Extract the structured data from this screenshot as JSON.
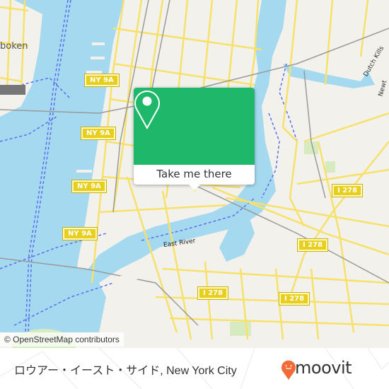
{
  "map": {
    "attribution": "© OpenStreetMap contributors",
    "place_labels": [
      {
        "id": "hoboken",
        "text": "boken"
      }
    ],
    "water_labels": [
      {
        "id": "east-river",
        "text": "East River"
      }
    ],
    "shields": [
      {
        "id": "ny9a-1",
        "text": "NY 9A"
      },
      {
        "id": "ny9a-2",
        "text": "NY 9A"
      },
      {
        "id": "ny9a-3",
        "text": "NY 9A"
      },
      {
        "id": "ny9a-4",
        "text": "NY 9A"
      },
      {
        "id": "i278-1",
        "text": "I 278"
      },
      {
        "id": "i278-2",
        "text": "I 278"
      },
      {
        "id": "i278-3",
        "text": "I 278"
      },
      {
        "id": "i278-4",
        "text": "I 278"
      }
    ],
    "street_labels": [
      {
        "id": "dutch-kills",
        "text": "Dutch Kills"
      },
      {
        "id": "newtown",
        "text": "Newt"
      }
    ],
    "colors": {
      "land": "#f2f1ec",
      "water": "#a4d9ef",
      "major_road": "#f7e16a",
      "road_casing": "#e7c93a",
      "rail": "#9a9a9a",
      "ferry": "#5b6ff0",
      "park": "#d7ebc0"
    }
  },
  "popup": {
    "button_label": "Take me there",
    "icon": "map-pin-icon",
    "color": "#1fb86a"
  },
  "footer": {
    "place_name": "ロウアー・イースト・サイド, New York City",
    "brand": "moovit",
    "brand_color": "#f26a36"
  }
}
